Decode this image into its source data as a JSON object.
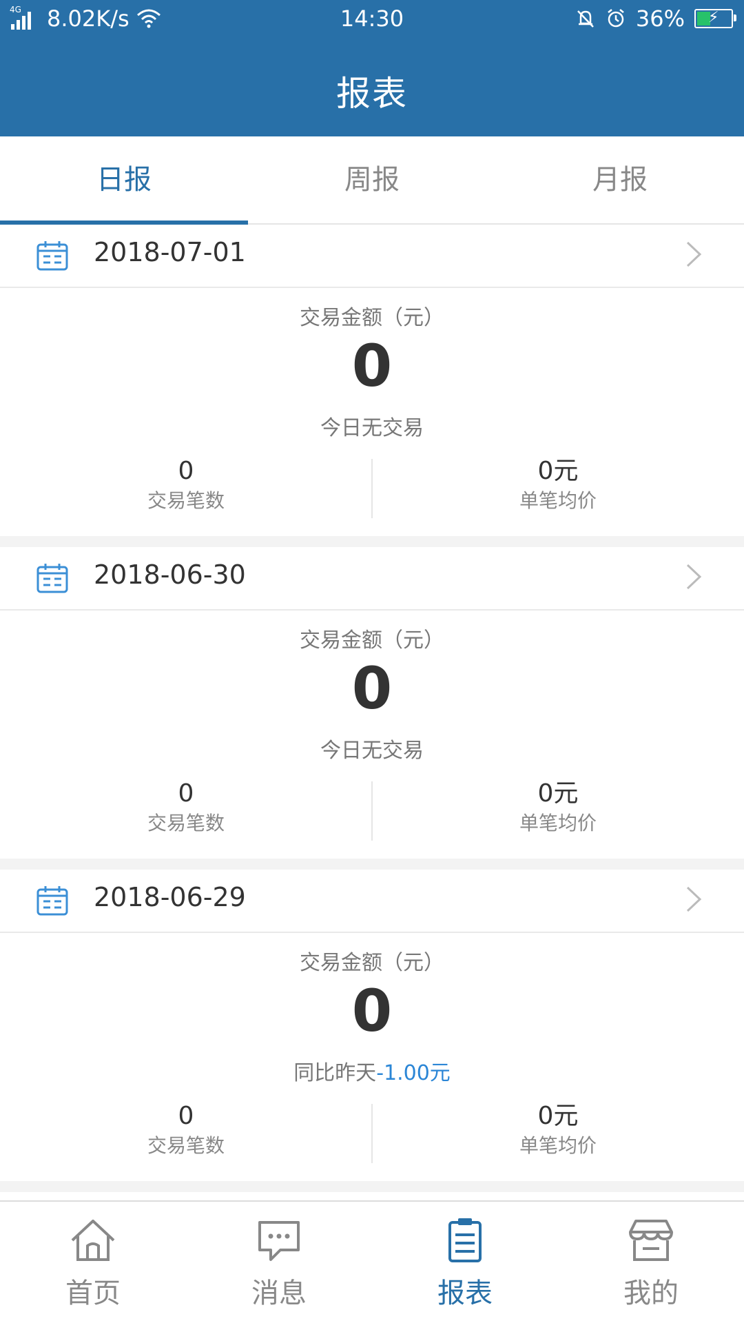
{
  "status_bar": {
    "network": "4G",
    "speed": "8.02K/s",
    "time": "14:30",
    "battery": "36%"
  },
  "header": {
    "title": "报表"
  },
  "tabs": [
    {
      "label": "日报",
      "active": true
    },
    {
      "label": "周报",
      "active": false
    },
    {
      "label": "月报",
      "active": false
    }
  ],
  "reports": [
    {
      "date": "2018-07-01",
      "amount_label": "交易金额（元）",
      "amount": "0",
      "note": "今日无交易",
      "note_cmp": "",
      "count": "0",
      "count_label": "交易笔数",
      "avg": "0元",
      "avg_label": "单笔均价"
    },
    {
      "date": "2018-06-30",
      "amount_label": "交易金额（元）",
      "amount": "0",
      "note": "今日无交易",
      "note_cmp": "",
      "count": "0",
      "count_label": "交易笔数",
      "avg": "0元",
      "avg_label": "单笔均价"
    },
    {
      "date": "2018-06-29",
      "amount_label": "交易金额（元）",
      "amount": "0",
      "note": "同比昨天",
      "note_cmp": "-1.00元",
      "count": "0",
      "count_label": "交易笔数",
      "avg": "0元",
      "avg_label": "单笔均价"
    }
  ],
  "bottom_nav": [
    {
      "label": "首页",
      "icon": "home-icon"
    },
    {
      "label": "消息",
      "icon": "message-icon"
    },
    {
      "label": "报表",
      "icon": "report-icon",
      "active": true
    },
    {
      "label": "我的",
      "icon": "store-icon"
    }
  ],
  "colors": {
    "brand": "#2870a8",
    "compare_accent": "#2b86d6",
    "icon_blue": "#3b8fd6"
  }
}
